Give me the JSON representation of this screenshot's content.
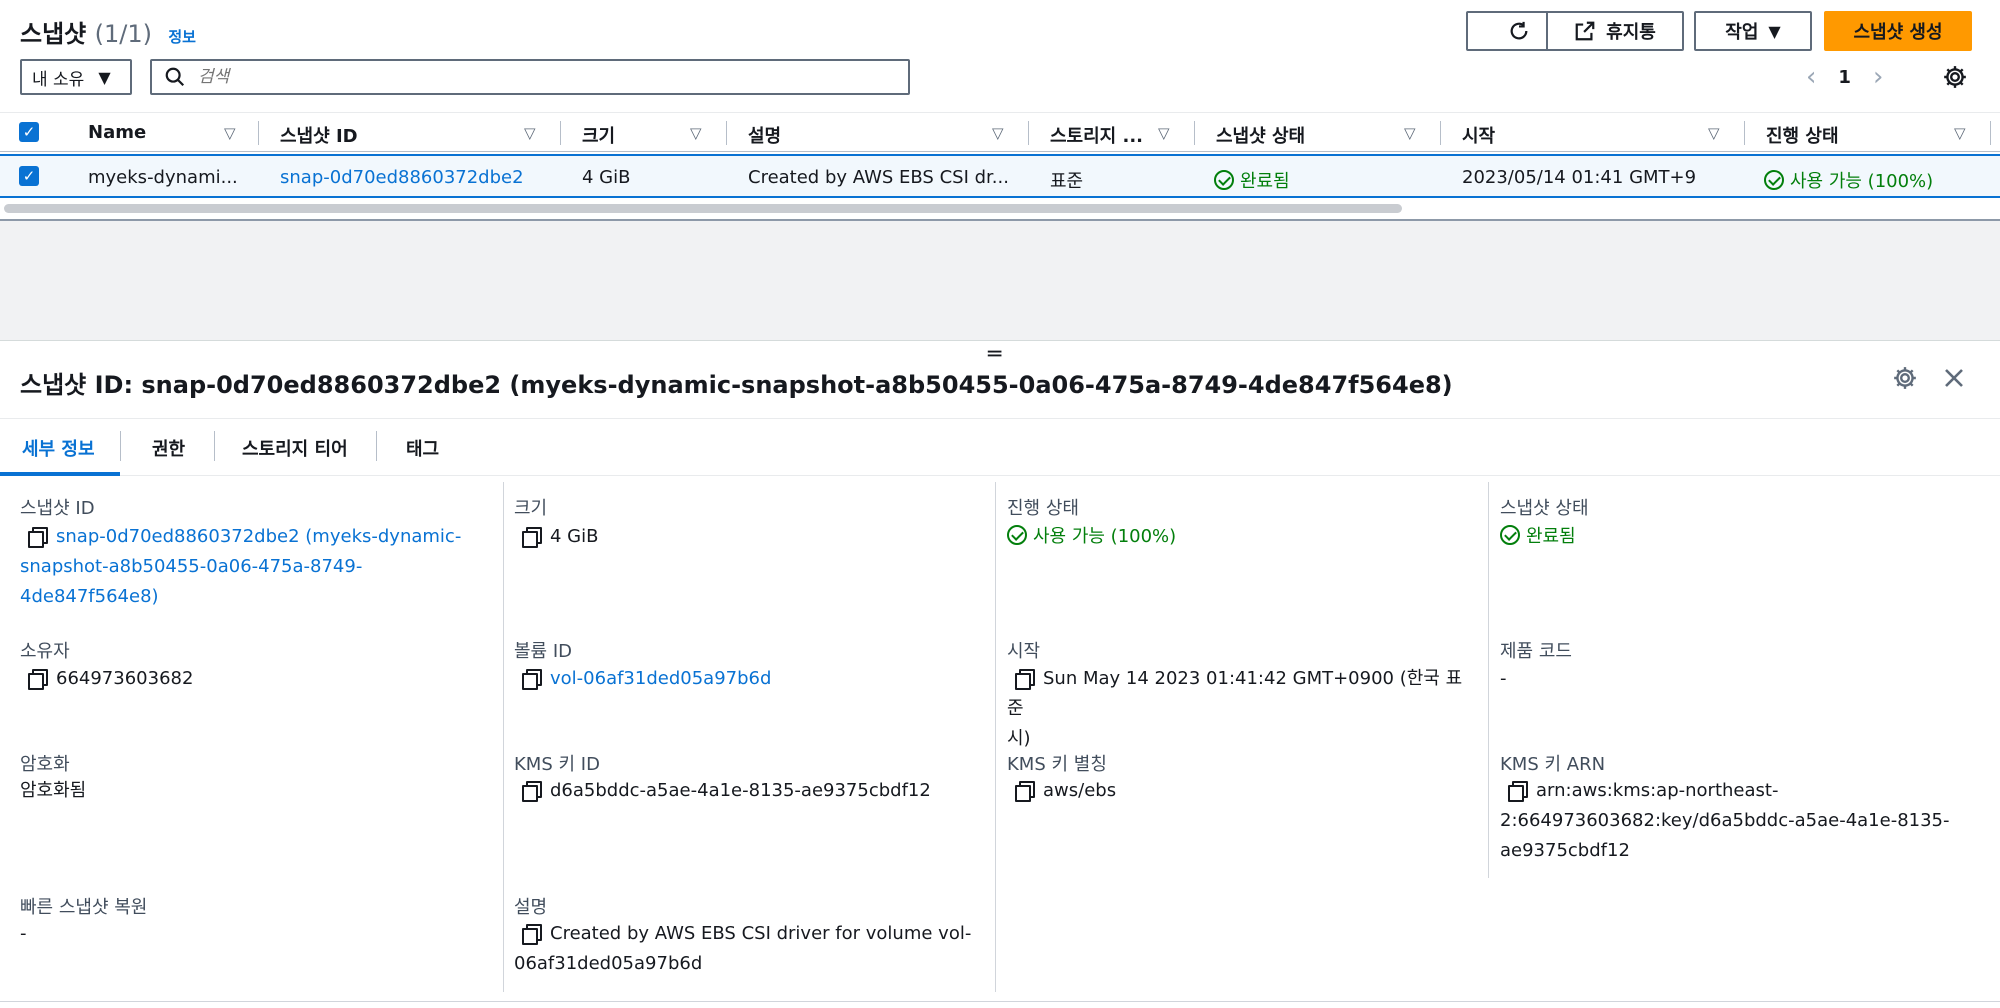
{
  "list": {
    "title": "스냅샷",
    "count": "(1/1)",
    "info": "정보",
    "buttons": {
      "recycle": "휴지통",
      "actions": "작업",
      "create": "스냅샷 생성"
    },
    "filter": {
      "selected": "내 소유"
    },
    "search": {
      "placeholder": "검색"
    },
    "pagination": {
      "page": "1"
    },
    "columns": [
      "Name",
      "스냅샷 ID",
      "크기",
      "설명",
      "스토리지 ...",
      "스냅샷 상태",
      "시작",
      "진행 상태"
    ],
    "row": {
      "name": "myeks-dynami...",
      "snapshot_id": "snap-0d70ed8860372dbe2",
      "size": "4 GiB",
      "description": "Created by AWS EBS CSI dr...",
      "storage": "표준",
      "state": "완료됨",
      "started": "2023/05/14 01:41 GMT+9",
      "progress": "사용 가능 (100%)"
    }
  },
  "detail": {
    "title": "스냅샷 ID: snap-0d70ed8860372dbe2 (myeks-dynamic-snapshot-a8b50455-0a06-475a-8749-4de847f564e8)",
    "tabs": [
      "세부 정보",
      "권한",
      "스토리지 티어",
      "태그"
    ],
    "fields": {
      "snapshot_id": {
        "label": "스냅샷 ID",
        "line1": "snap-0d70ed8860372dbe2 (myeks-dynamic-",
        "line2": "snapshot-a8b50455-0a06-475a-8749-",
        "line3": "4de847f564e8)"
      },
      "size": {
        "label": "크기",
        "value": "4 GiB"
      },
      "progress": {
        "label": "진행 상태",
        "value": "사용 가능 (100%)"
      },
      "state": {
        "label": "스냅샷 상태",
        "value": "완료됨"
      },
      "owner": {
        "label": "소유자",
        "value": "664973603682"
      },
      "volume_id": {
        "label": "볼륨 ID",
        "value": "vol-06af31ded05a97b6d"
      },
      "started": {
        "label": "시작",
        "line1": "Sun May 14 2023 01:41:42 GMT+0900 (한국 표준",
        "line2": "시)"
      },
      "product_code": {
        "label": "제품 코드",
        "value": "-"
      },
      "encryption": {
        "label": "암호화",
        "value": "암호화됨"
      },
      "kms_key_id": {
        "label": "KMS 키 ID",
        "value": "d6a5bddc-a5ae-4a1e-8135-ae9375cbdf12"
      },
      "kms_alias": {
        "label": "KMS 키 별칭",
        "value": "aws/ebs"
      },
      "kms_arn": {
        "label": "KMS 키 ARN",
        "line1": "arn:aws:kms:ap-northeast-",
        "line2": "2:664973603682:key/d6a5bddc-a5ae-4a1e-8135-",
        "line3": "ae9375cbdf12"
      },
      "fast_restore": {
        "label": "빠른 스냅샷 복원",
        "value": "-"
      },
      "description": {
        "label": "설명",
        "line1": "Created by AWS EBS CSI driver for volume vol-",
        "line2": "06af31ded05a97b6d"
      }
    }
  },
  "colors": {
    "primary": "#ff9900",
    "link": "#0972d3",
    "success": "#037f0c",
    "selected_row": "#f2f8fd"
  }
}
